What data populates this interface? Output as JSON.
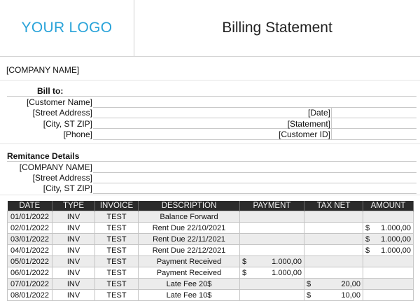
{
  "header": {
    "logo": "YOUR LOGO",
    "title": "Billing Statement"
  },
  "company_name": "[COMPANY NAME]",
  "bill_to": {
    "heading": "Bill to:",
    "customer_name": "[Customer Name]",
    "street": "[Street Address]",
    "city": "[City, ST ZIP]",
    "phone": "[Phone]"
  },
  "statement_info": {
    "date": "[Date]",
    "statement": "[Statement]",
    "customer_id": "[Customer ID]"
  },
  "remittance": {
    "heading": "Remitance Details",
    "company": "[COMPANY NAME]",
    "street": "[Street Address]",
    "city": "[City, ST ZIP]"
  },
  "table": {
    "headers": [
      "DATE",
      "TYPE",
      "INVOICE",
      "DESCRIPTION",
      "PAYMENT",
      "TAX NET",
      "AMOUNT"
    ],
    "currency": "$",
    "rows": [
      {
        "date": "01/01/2022",
        "type": "INV",
        "invoice": "TEST",
        "description": "Balance Forward",
        "payment": "",
        "tax": "",
        "amount": ""
      },
      {
        "date": "02/01/2022",
        "type": "INV",
        "invoice": "TEST",
        "description": "Rent Due 22/10/2021",
        "payment": "",
        "tax": "",
        "amount": "1.000,00"
      },
      {
        "date": "03/01/2022",
        "type": "INV",
        "invoice": "TEST",
        "description": "Rent Due 22/11/2021",
        "payment": "",
        "tax": "",
        "amount": "1.000,00"
      },
      {
        "date": "04/01/2022",
        "type": "INV",
        "invoice": "TEST",
        "description": "Rent Due 22/12/2021",
        "payment": "",
        "tax": "",
        "amount": "1.000,00"
      },
      {
        "date": "05/01/2022",
        "type": "INV",
        "invoice": "TEST",
        "description": "Payment Received",
        "payment": "1.000,00",
        "tax": "",
        "amount": ""
      },
      {
        "date": "06/01/2022",
        "type": "INV",
        "invoice": "TEST",
        "description": "Payment Received",
        "payment": "1.000,00",
        "tax": "",
        "amount": ""
      },
      {
        "date": "07/01/2022",
        "type": "INV",
        "invoice": "TEST",
        "description": "Late Fee 20$",
        "payment": "",
        "tax": "20,00",
        "amount": ""
      },
      {
        "date": "08/01/2022",
        "type": "INV",
        "invoice": "TEST",
        "description": "Late Fee 10$",
        "payment": "",
        "tax": "10,00",
        "amount": ""
      }
    ]
  }
}
